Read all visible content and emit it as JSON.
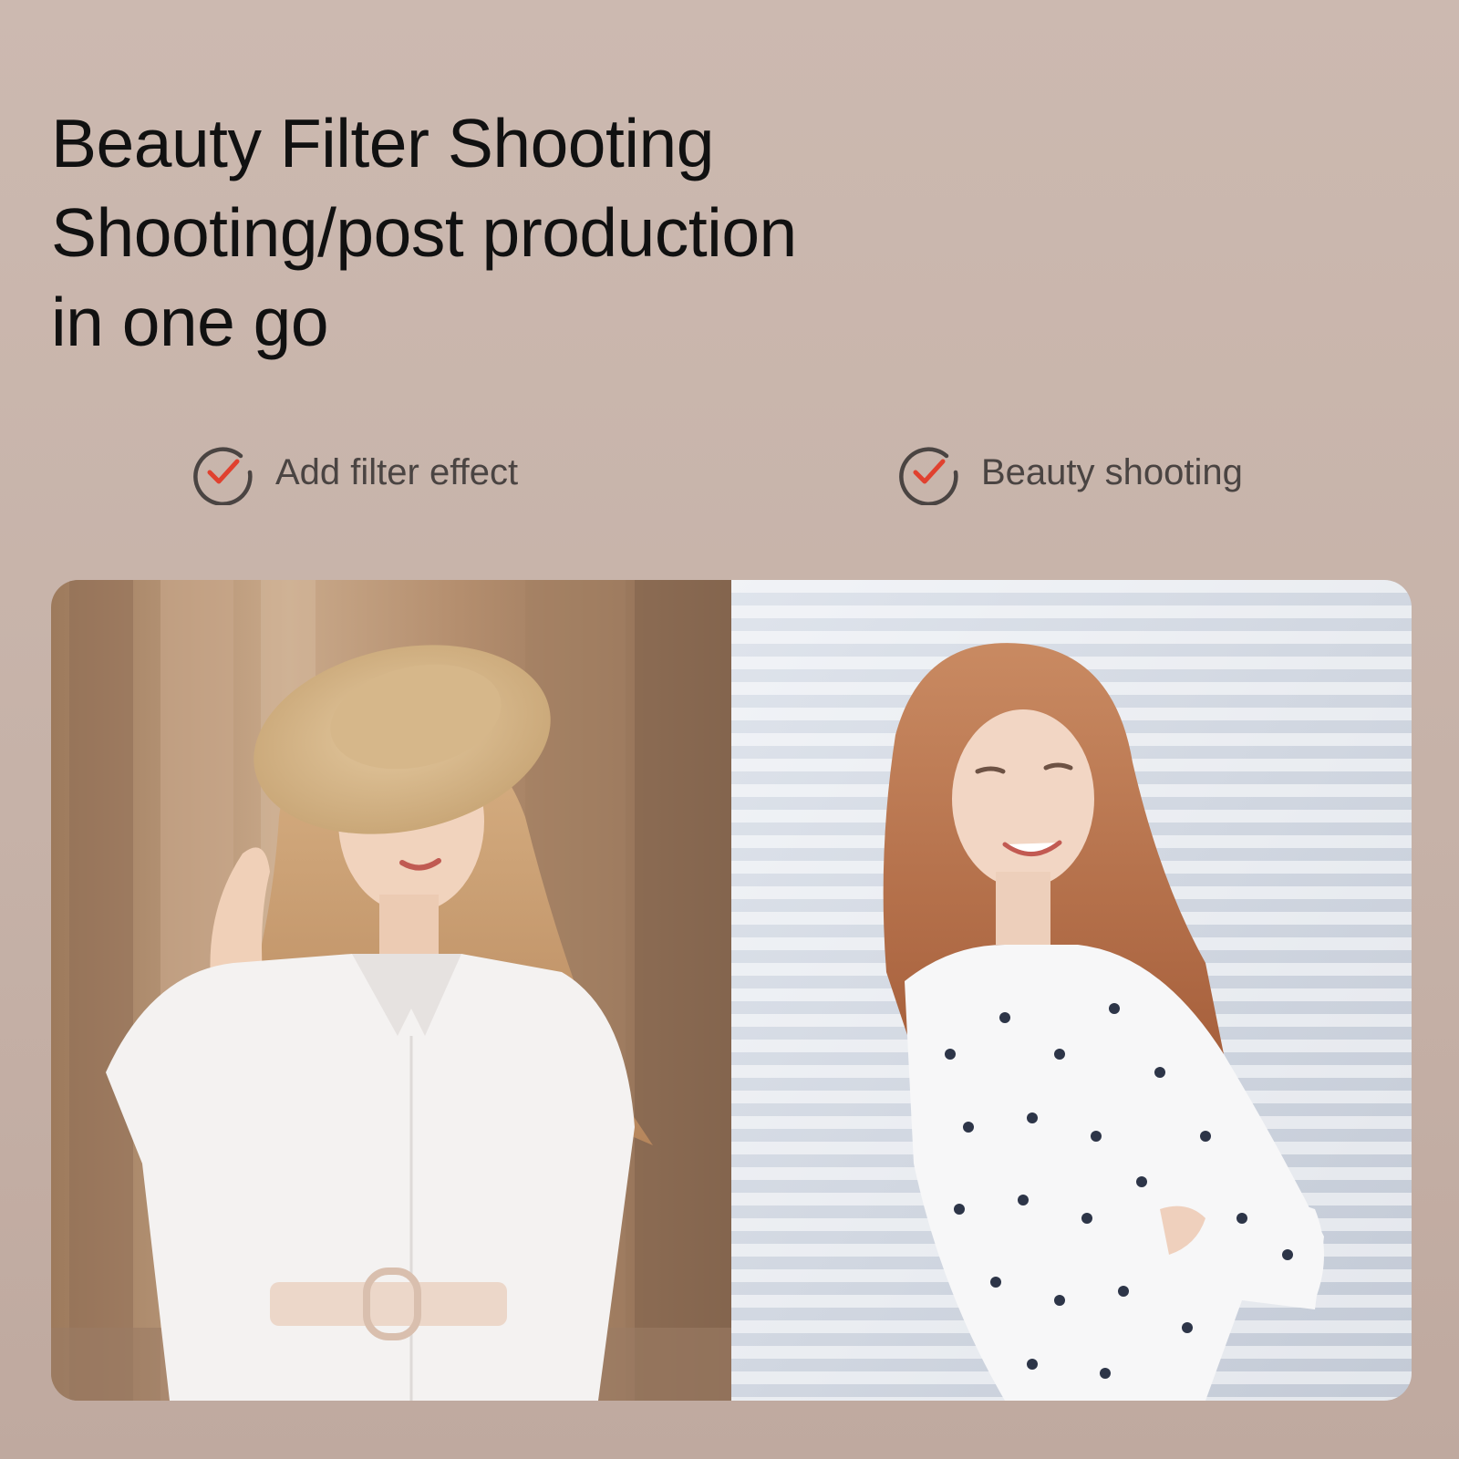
{
  "headline": {
    "line1": "Beauty Filter Shooting",
    "line2": "Shooting/post production",
    "line3": "in one go"
  },
  "features": [
    {
      "label": "Add filter effect",
      "icon": "check-circle-icon"
    },
    {
      "label": "Beauty shooting",
      "icon": "check-circle-icon"
    }
  ],
  "colors": {
    "background": "#c9b5ab",
    "headline_text": "#111111",
    "feature_text": "#4a4442",
    "check_ring": "#4a4442",
    "check_mark": "#e0412f"
  },
  "photos": [
    {
      "subject": "woman in straw hat and white shirt, warm filter"
    },
    {
      "subject": "woman in polka-dot blouse leaning on striped wall"
    }
  ]
}
